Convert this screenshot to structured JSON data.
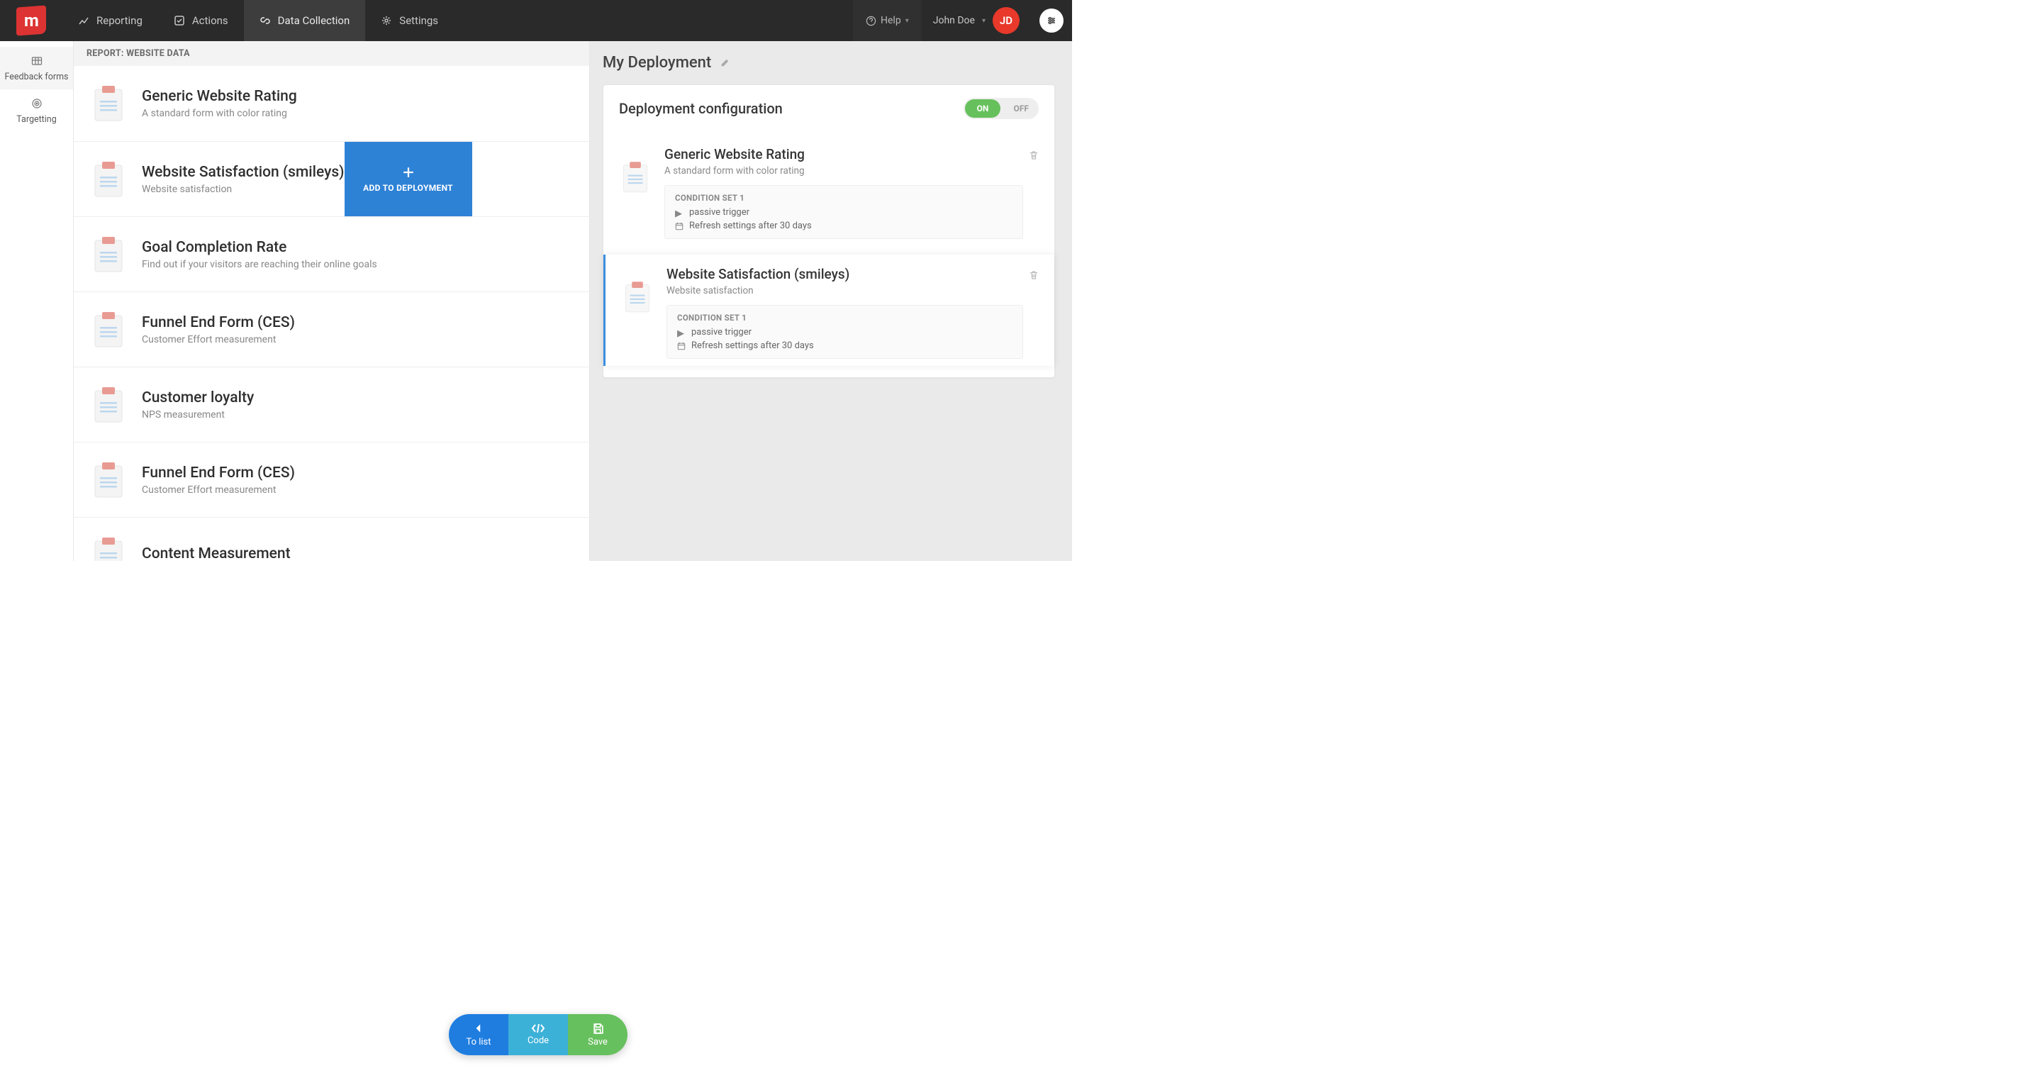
{
  "nav": {
    "tabs": [
      {
        "label": "Reporting"
      },
      {
        "label": "Actions"
      },
      {
        "label": "Data Collection"
      },
      {
        "label": "Settings"
      }
    ],
    "help": "Help",
    "user_name": "John Doe",
    "user_initials": "JD"
  },
  "sidebar": {
    "items": [
      {
        "label": "Feedback forms"
      },
      {
        "label": "Targetting"
      }
    ]
  },
  "report": {
    "header": "REPORT: WEBSITE DATA",
    "add_label": "ADD TO DEPLOYMENT",
    "items": [
      {
        "title": "Generic Website Rating",
        "desc": "A standard form with color rating"
      },
      {
        "title": "Website Satisfaction (smileys)",
        "desc": "Website satisfaction"
      },
      {
        "title": "Goal Completion Rate",
        "desc": "Find out if your visitors are reaching their online goals"
      },
      {
        "title": "Funnel End Form (CES)",
        "desc": "Customer Effort measurement"
      },
      {
        "title": "Customer loyalty",
        "desc": "NPS measurement"
      },
      {
        "title": "Funnel End Form (CES)",
        "desc": "Customer Effort measurement"
      },
      {
        "title": "Content Measurement",
        "desc": ""
      }
    ]
  },
  "deployment": {
    "title": "My Deployment",
    "config_title": "Deployment configuration",
    "toggle_on": "ON",
    "toggle_off": "OFF",
    "condition_set_label": "CONDITION SET 1",
    "trigger_text": "passive trigger",
    "refresh_text": "Refresh settings after 30 days",
    "entries": [
      {
        "title": "Generic Website Rating",
        "desc": "A standard form with color rating"
      },
      {
        "title": "Website Satisfaction (smileys)",
        "desc": "Website satisfaction"
      }
    ]
  },
  "actions": {
    "to_list": "To list",
    "code": "Code",
    "save": "Save"
  }
}
